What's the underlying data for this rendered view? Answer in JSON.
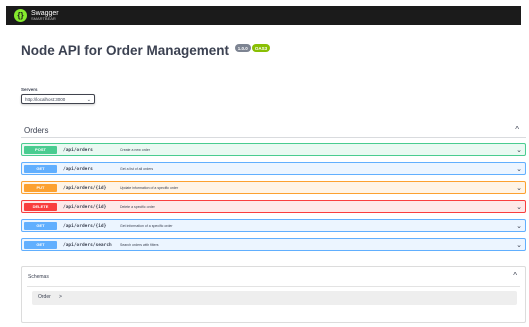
{
  "topbar": {
    "logo_mark": "{}",
    "brand": "Swagger",
    "brand_sub": "SMARTBEAR"
  },
  "info": {
    "title": "Node API for Order Management",
    "version_badge": "1.0.0",
    "oas_badge": "OAS3"
  },
  "servers": {
    "label": "Servers",
    "selected": "http://localhost:3000"
  },
  "tag": {
    "name": "Orders",
    "toggle_icon": "chevron-up-icon"
  },
  "operations": [
    {
      "method": "POST",
      "path": "/api/orders",
      "summary": "Create a new order"
    },
    {
      "method": "GET",
      "path": "/api/orders",
      "summary": "Get a list of all orders"
    },
    {
      "method": "PUT",
      "path": "/api/orders/{id}",
      "summary": "Update information of a specific order"
    },
    {
      "method": "DELETE",
      "path": "/api/orders/{id}",
      "summary": "Delete a specific order"
    },
    {
      "method": "GET",
      "path": "/api/orders/{id}",
      "summary": "Get information of a specific order"
    },
    {
      "method": "GET",
      "path": "/api/orders/search",
      "summary": "Search orders with filters"
    }
  ],
  "schemas": {
    "title": "Schemas",
    "models": [
      {
        "name": "Order",
        "caret": ">"
      }
    ]
  },
  "icons": {
    "chevron_down": "⌄",
    "chevron_up": "^",
    "select_caret": "⌄"
  },
  "colors": {
    "post": "#49cc90",
    "get": "#61affe",
    "put": "#fca130",
    "delete": "#f93e3e",
    "topbar": "#1b1b1b",
    "brand_green": "#85ea2d"
  }
}
